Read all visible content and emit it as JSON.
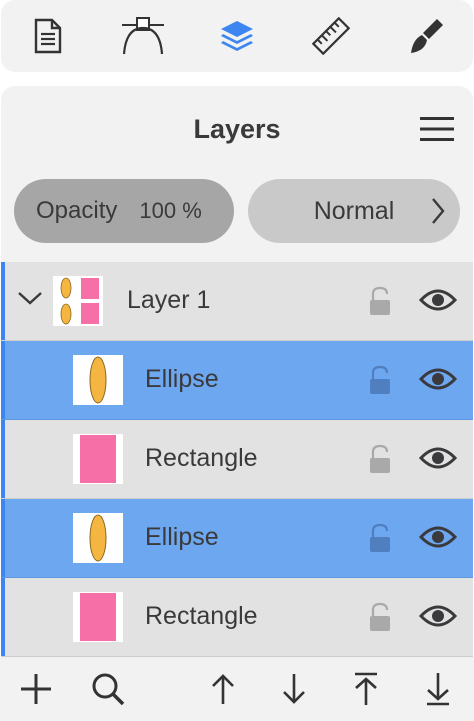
{
  "toolbar": {
    "items": [
      {
        "icon": "document-icon",
        "active": false
      },
      {
        "icon": "bezier-pen-icon",
        "active": false
      },
      {
        "icon": "layers-icon",
        "active": true
      },
      {
        "icon": "ruler-icon",
        "active": false
      },
      {
        "icon": "brush-icon",
        "active": false
      }
    ]
  },
  "panel": {
    "title": "Layers",
    "menu_icon": "hamburger-menu-icon"
  },
  "controls": {
    "opacity_label": "Opacity",
    "opacity_value": "100 %",
    "blend_mode": "Normal"
  },
  "layers": [
    {
      "name": "Layer 1",
      "type": "group",
      "expanded": true,
      "selected": false
    },
    {
      "name": "Ellipse",
      "type": "ellipse",
      "selected": true
    },
    {
      "name": "Rectangle",
      "type": "rectangle",
      "selected": false
    },
    {
      "name": "Ellipse",
      "type": "ellipse",
      "selected": true
    },
    {
      "name": "Rectangle",
      "type": "rectangle",
      "selected": false
    }
  ],
  "bottombar": {
    "items": [
      "add-icon",
      "search-icon",
      "move-up-icon",
      "move-down-icon",
      "move-to-top-icon",
      "move-to-bottom-icon"
    ]
  },
  "colors": {
    "accent": "#3d86f2",
    "selected_row": "#6da7f0",
    "ellipse_fill": "#f4b541",
    "rect_fill": "#f66fa6"
  }
}
